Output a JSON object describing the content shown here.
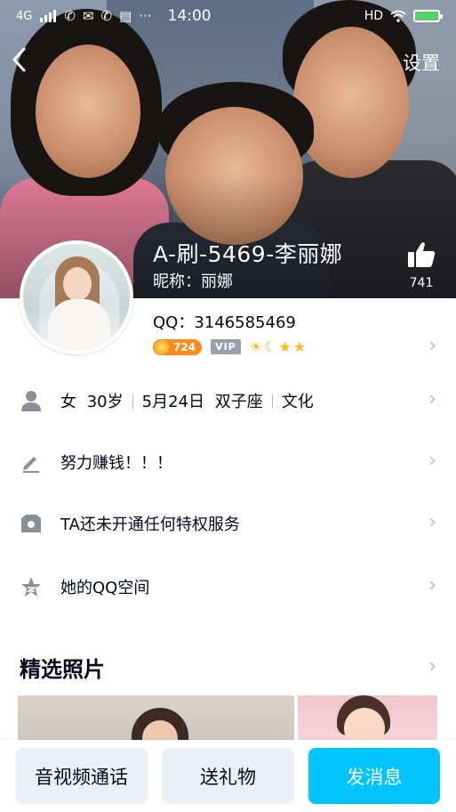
{
  "status_bar": {
    "network": "4G",
    "time": "14:00",
    "hd": "HD",
    "more": "···"
  },
  "nav": {
    "back_icon": "‹",
    "settings_label": "设置"
  },
  "profile": {
    "name": "A-刷-5469-李丽娜",
    "nickname_label": "昵称：",
    "nickname": "丽娜",
    "likes": "741",
    "qq_label": "QQ：",
    "qq_number": "3146585469",
    "level": "724",
    "vip": "VIP"
  },
  "info_rows": {
    "basic": {
      "gender": "女",
      "age": "30岁",
      "birthday": "5月24日",
      "zodiac": "双子座",
      "occupation": "文化"
    },
    "signature": "努力赚钱！！！",
    "privilege": "TA还未开通任何特权服务",
    "qzone": "她的QQ空间"
  },
  "photos_section": {
    "title": "精选照片"
  },
  "bottom_actions": {
    "call": "音视频通话",
    "gift": "送礼物",
    "message": "发消息"
  },
  "colors": {
    "primary": "#00c4ff",
    "secondary_bg": "#edeff7",
    "level_badge": "#ff8a1e",
    "icon_gray": "#8a8f99"
  }
}
